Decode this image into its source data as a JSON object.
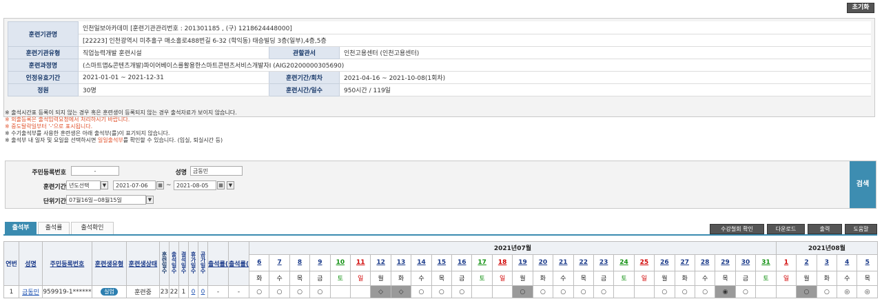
{
  "reset_label": "초기화",
  "info": {
    "rows": [
      {
        "label": "훈련기관명",
        "value1": "인천일보아카데미  [훈련기관관리번호 : 201301185 , (구) 1218624448000]",
        "value2": "[22223] 인천광역시 미추홀구 매소홀로488번길 6-32 (학익동) 태승빌딩 3층(일부),4층,5층"
      },
      {
        "label": "훈련기관유형",
        "value": "직업능력개발 훈련시설",
        "label2": "관할관서",
        "value2": "인천고용센터 (인천고용센터)"
      },
      {
        "label": "훈련과정명",
        "value": "(스마트앱&콘텐츠개발)파이어베이스를활용한스마트콘텐츠서비스개발자Ⅰ (AIG20200000305690)"
      },
      {
        "label": "인정유효기간",
        "value": "2021-01-01 ~ 2021-12-31",
        "label2": "훈련기간/회차",
        "value2": "2021-04-16 ~ 2021-10-08(1회차)"
      },
      {
        "label": "정원",
        "value": "30명",
        "label2": "훈련시간/일수",
        "value2": "950시간 / 119일"
      }
    ]
  },
  "notices": [
    {
      "text": "※ 출석시간표 등록이 되지 않는 경우 혹은 훈련생이 등록되지 않는 경우 출석자료가 보이지 않습니다.",
      "color": "#333333"
    },
    {
      "text": "※ 외출등록은 출석입력요청에서 처리하시기 바랍니다.",
      "color": "#e0502a"
    },
    {
      "text": "※ 중도탈락일부터 '-'으로 표시됩니다.",
      "color": "#e0502a"
    },
    {
      "text": "※ 수기출석부를 사용한 훈련생은 아래 출석부(를)이 표기되지 않습니다.",
      "color": "#333333"
    }
  ],
  "notice_last": {
    "pre": "※ 출석부 내 일자 및 요일을 선택하시면 ",
    "em": "일일출석부",
    "post": "를 확인할 수 있습니다. (입실, 퇴실시간 등)"
  },
  "search": {
    "rrn_label": "주민등록번호",
    "rrn_value": "-",
    "name_label": "성명",
    "name_value": "금동민",
    "period_label": "훈련기간",
    "period_select": "년도선택",
    "date_from": "2021-07-06",
    "tilde": "~",
    "date_to": "2021-08-05",
    "unit_label": "단위기간",
    "unit_value": "07월16일~08월15일",
    "search_button": "검색"
  },
  "tabs": [
    "출석부",
    "출석률",
    "출석확인"
  ],
  "right_buttons": [
    "수강철회 확인",
    "다운로드",
    "출력",
    "도움말"
  ],
  "grid": {
    "headers": {
      "no": "연번",
      "name": "성명",
      "rrn": "주민등록번호",
      "type": "훈련생유형",
      "status": "훈련생상태",
      "train_days": "훈련일수",
      "attend_days": "출석일수",
      "absent_days": "결석일수",
      "leave_days": "휴가일수",
      "official_days": "공가일수",
      "attend_rate": "출석률(%)",
      "attend_rate2": "출석률(%)"
    },
    "month1": "2021년07월",
    "month2": "2021년08월",
    "days": [
      {
        "d": "6",
        "w": "화",
        "c": ""
      },
      {
        "d": "7",
        "w": "수",
        "c": ""
      },
      {
        "d": "8",
        "w": "목",
        "c": ""
      },
      {
        "d": "9",
        "w": "금",
        "c": ""
      },
      {
        "d": "10",
        "w": "토",
        "c": "grn"
      },
      {
        "d": "11",
        "w": "일",
        "c": "red"
      },
      {
        "d": "12",
        "w": "월",
        "c": ""
      },
      {
        "d": "13",
        "w": "화",
        "c": ""
      },
      {
        "d": "14",
        "w": "수",
        "c": ""
      },
      {
        "d": "15",
        "w": "목",
        "c": ""
      },
      {
        "d": "16",
        "w": "금",
        "c": ""
      },
      {
        "d": "17",
        "w": "토",
        "c": "grn"
      },
      {
        "d": "18",
        "w": "일",
        "c": "red"
      },
      {
        "d": "19",
        "w": "월",
        "c": ""
      },
      {
        "d": "20",
        "w": "화",
        "c": ""
      },
      {
        "d": "21",
        "w": "수",
        "c": ""
      },
      {
        "d": "22",
        "w": "목",
        "c": ""
      },
      {
        "d": "23",
        "w": "금",
        "c": ""
      },
      {
        "d": "24",
        "w": "토",
        "c": "grn"
      },
      {
        "d": "25",
        "w": "일",
        "c": "red"
      },
      {
        "d": "26",
        "w": "월",
        "c": ""
      },
      {
        "d": "27",
        "w": "화",
        "c": ""
      },
      {
        "d": "28",
        "w": "수",
        "c": ""
      },
      {
        "d": "29",
        "w": "목",
        "c": ""
      },
      {
        "d": "30",
        "w": "금",
        "c": ""
      },
      {
        "d": "31",
        "w": "토",
        "c": "grn"
      },
      {
        "d": "1",
        "w": "일",
        "c": "red"
      },
      {
        "d": "2",
        "w": "월",
        "c": ""
      },
      {
        "d": "3",
        "w": "화",
        "c": ""
      },
      {
        "d": "4",
        "w": "수",
        "c": ""
      },
      {
        "d": "5",
        "w": "목",
        "c": ""
      }
    ],
    "row": {
      "no": "1",
      "name": "금동민",
      "rrn": "959919-1******",
      "type": "실업",
      "status": "훈련중",
      "train_days": "23",
      "attend_days": "22",
      "absent_days": "1",
      "leave_days": "0",
      "official_days": "0",
      "attend_rate": "-",
      "attend_rate2": "-",
      "marks": [
        "○",
        "○",
        "○",
        "○",
        "",
        "",
        "◇",
        "◇",
        "○",
        "○",
        "○",
        "",
        "",
        "○",
        "○",
        "○",
        "○",
        "○",
        "",
        "",
        "○",
        "○",
        "○",
        "◉",
        "○",
        "",
        "",
        "○",
        "○",
        "◎",
        "◎"
      ],
      "gray": [
        false,
        false,
        false,
        false,
        false,
        false,
        true,
        true,
        false,
        false,
        false,
        false,
        false,
        true,
        false,
        false,
        false,
        false,
        false,
        false,
        false,
        false,
        false,
        true,
        false,
        false,
        false,
        true,
        false,
        false,
        false
      ]
    }
  }
}
